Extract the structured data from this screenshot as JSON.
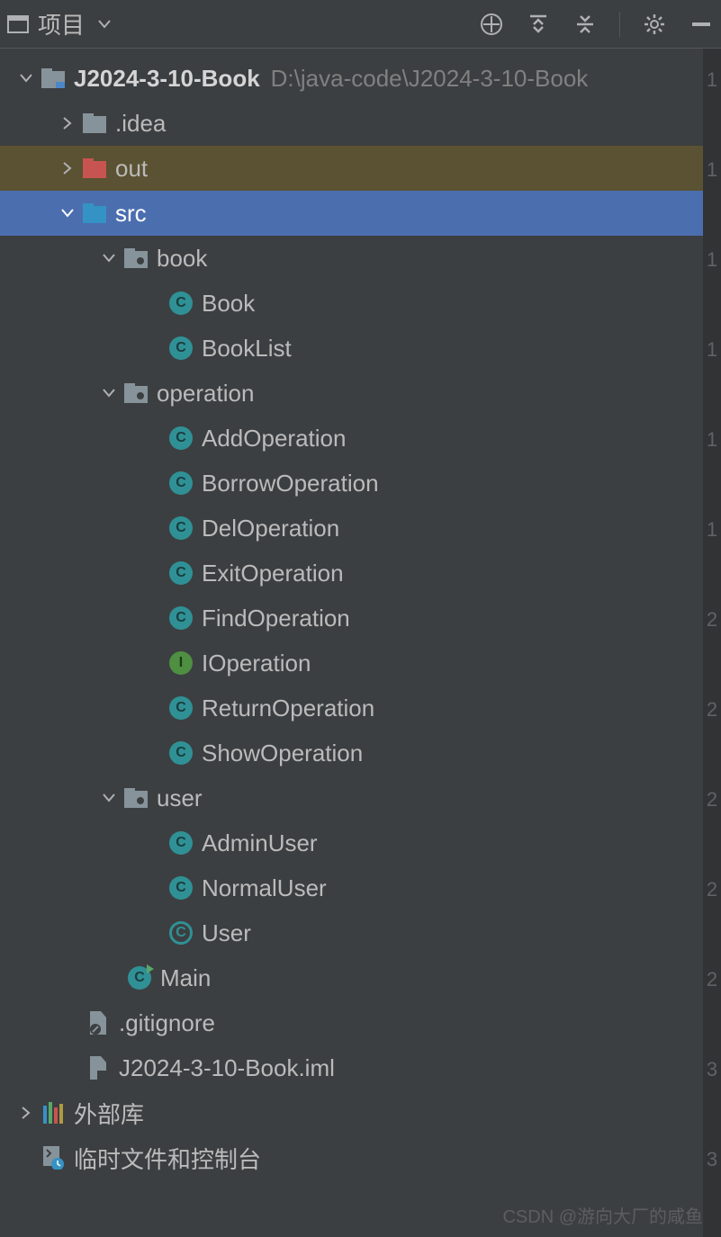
{
  "toolbar": {
    "title": "项目"
  },
  "tree": {
    "root": {
      "name": "J2024-3-10-Book",
      "path": "D:\\java-code\\J2024-3-10-Book"
    },
    "idea": ".idea",
    "out": "out",
    "src": "src",
    "book_pkg": "book",
    "book": "Book",
    "booklist": "BookList",
    "operation_pkg": "operation",
    "addop": "AddOperation",
    "borrowop": "BorrowOperation",
    "delop": "DelOperation",
    "exitop": "ExitOperation",
    "findop": "FindOperation",
    "iop": "IOperation",
    "returnop": "ReturnOperation",
    "showop": "ShowOperation",
    "user_pkg": "user",
    "adminuser": "AdminUser",
    "normaluser": "NormalUser",
    "user_cls": "User",
    "main": "Main",
    "gitignore": ".gitignore",
    "iml": "J2024-3-10-Book.iml",
    "external": "外部库",
    "scratch": "临时文件和控制台"
  },
  "gutter": [
    "1",
    "",
    "1",
    "",
    "1",
    "",
    "1",
    "",
    "1",
    "",
    "1",
    "",
    "2",
    "",
    "2",
    "",
    "2",
    "",
    "2",
    "",
    "2",
    "",
    "3",
    "",
    "3",
    ""
  ],
  "watermark": "CSDN @游向大厂的咸鱼"
}
